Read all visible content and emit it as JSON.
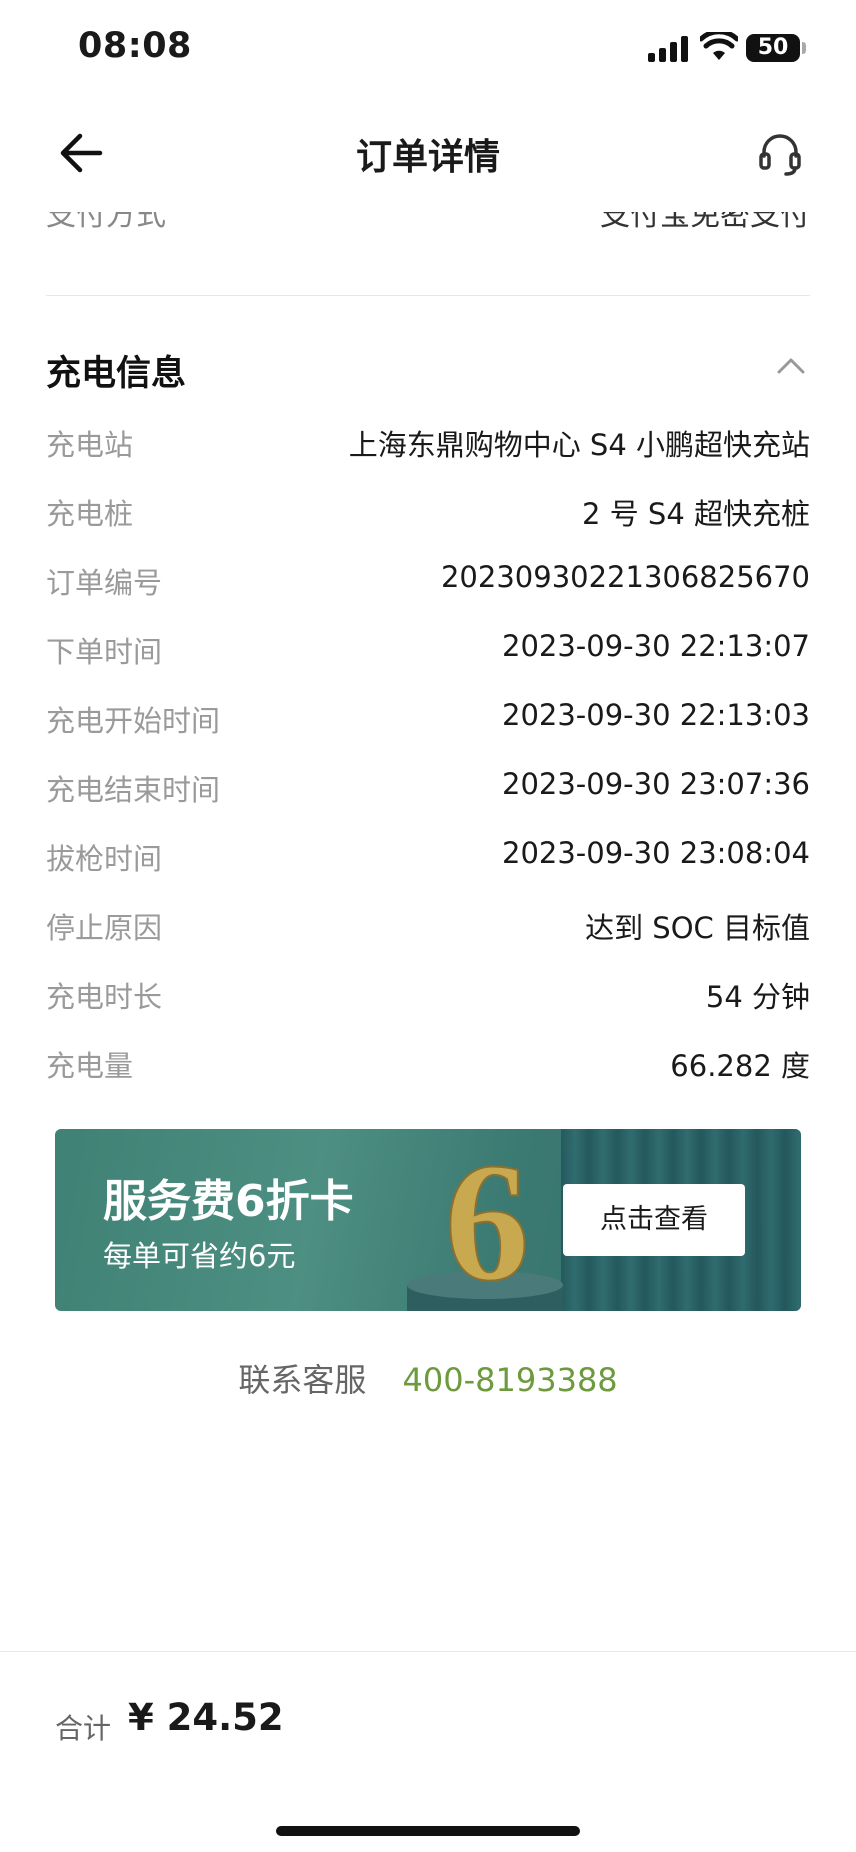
{
  "status_bar": {
    "time": "08:08",
    "battery": "50"
  },
  "nav": {
    "title": "订单详情"
  },
  "cut_row": {
    "label": "支付方式",
    "value": "支付宝免密支付"
  },
  "section": {
    "title": "充电信息"
  },
  "rows": [
    {
      "label": "充电站",
      "value": "上海东鼎购物中心 S4 小鹏超快充站"
    },
    {
      "label": "充电桩",
      "value": "2 号 S4 超快充桩"
    },
    {
      "label": "订单编号",
      "value": "20230930221306825670"
    },
    {
      "label": "下单时间",
      "value": "2023-09-30 22:13:07"
    },
    {
      "label": "充电开始时间",
      "value": "2023-09-30 22:13:03"
    },
    {
      "label": "充电结束时间",
      "value": "2023-09-30 23:07:36"
    },
    {
      "label": "拔枪时间",
      "value": "2023-09-30 23:08:04"
    },
    {
      "label": "停止原因",
      "value": "达到 SOC 目标值"
    },
    {
      "label": "充电时长",
      "value": "54 分钟"
    },
    {
      "label": "充电量",
      "value": "66.282 度"
    }
  ],
  "promo": {
    "title": "服务费6折卡",
    "subtitle": "每单可省约6元",
    "big_number": "6",
    "button": "点击查看"
  },
  "contact": {
    "label": "联系客服",
    "phone": "400-8193388",
    "phone_color": "#6e9a3e"
  },
  "footer": {
    "total_label": "合计",
    "total_value": "¥ 24.52"
  }
}
